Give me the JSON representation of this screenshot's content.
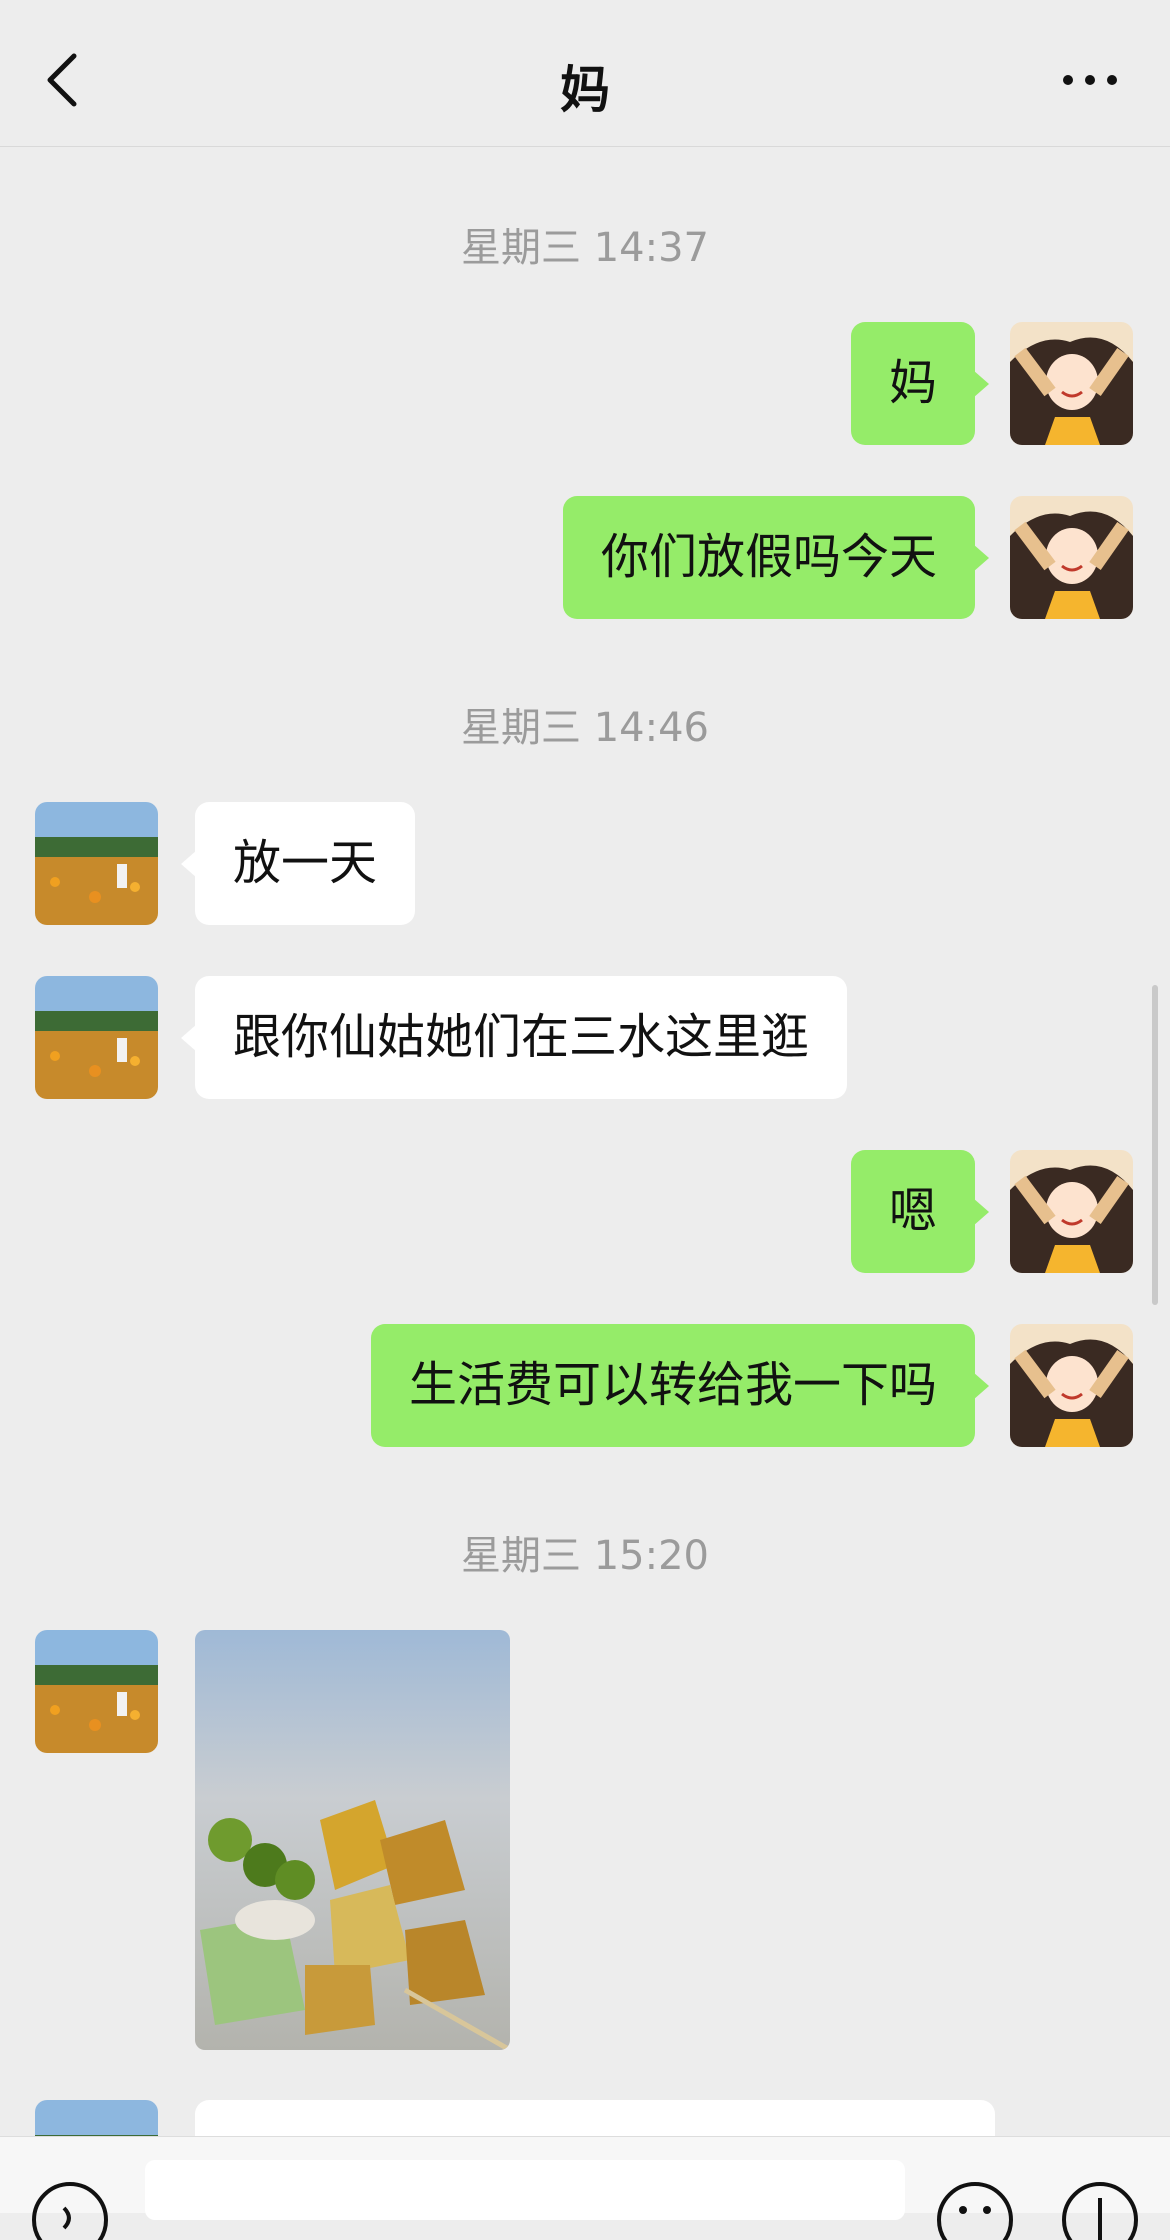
{
  "header": {
    "title": "妈"
  },
  "timestamps": [
    "星期三 14:37",
    "星期三 14:46",
    "星期三 15:20"
  ],
  "messages": {
    "m1": "妈",
    "m2": "你们放假吗今天",
    "m3": "放一天",
    "m4": "跟你仙姑她们在三水这里逛",
    "m5": "嗯",
    "m6": "生活费可以转给我一下吗"
  },
  "colors": {
    "outgoing_bubble": "#95ec69",
    "incoming_bubble": "#ffffff",
    "background": "#ededed"
  },
  "icons": [
    "back-icon",
    "more-icon",
    "voice-icon",
    "emoji-icon",
    "plus-icon"
  ]
}
